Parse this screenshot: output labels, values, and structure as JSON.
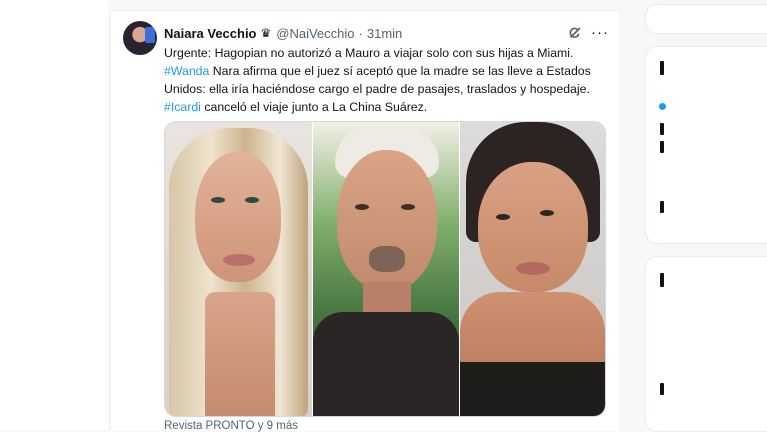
{
  "tweet": {
    "author_name": "Naiara Vecchio",
    "verified_badge": "♛",
    "handle": "@NaiVecchio",
    "separator": "·",
    "time": "31min",
    "more": "···",
    "text": {
      "line1": "Urgente: Hagopian no autorizó a Mauro a viajar solo con sus hijas a Miami.",
      "line2_tag": "#Wanda",
      "line2_rest": " Nara afirma que el juez sí aceptó que la madre se las lleve a Estados",
      "line3": "Unidos: ella iría haciéndose cargo el padre de pasajes, traslados y hospedaje.",
      "line4_tag": "#Icardi",
      "line4_rest": " canceló el viaje junto a La China Suárez."
    },
    "media_footer": "Revista PRONTO y 9 más"
  },
  "icons": {
    "avatar": "avatar-photo",
    "badge": "crown-badge-icon",
    "grok": "grok-icon",
    "more": "more-icon"
  },
  "colors": {
    "link": "#1d9bf0",
    "text": "#0f1419",
    "secondary": "#536471",
    "border": "#cfd9de"
  }
}
